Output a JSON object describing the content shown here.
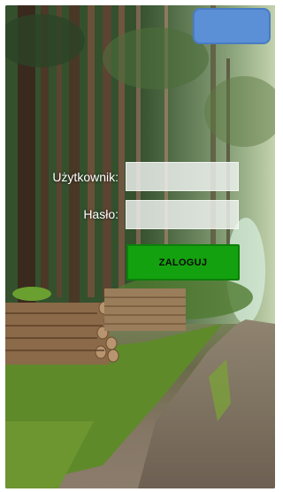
{
  "form": {
    "username_label": "Użytkownik:",
    "username_value": "",
    "password_label": "Hasło:",
    "password_value": "",
    "login_label": "ZALOGUJ"
  },
  "colors": {
    "top_button": "#5b8fd6",
    "login_button": "#14a10f",
    "field_bg": "#f0f4f2"
  },
  "background": {
    "description_icon": "forest-road-photo"
  }
}
